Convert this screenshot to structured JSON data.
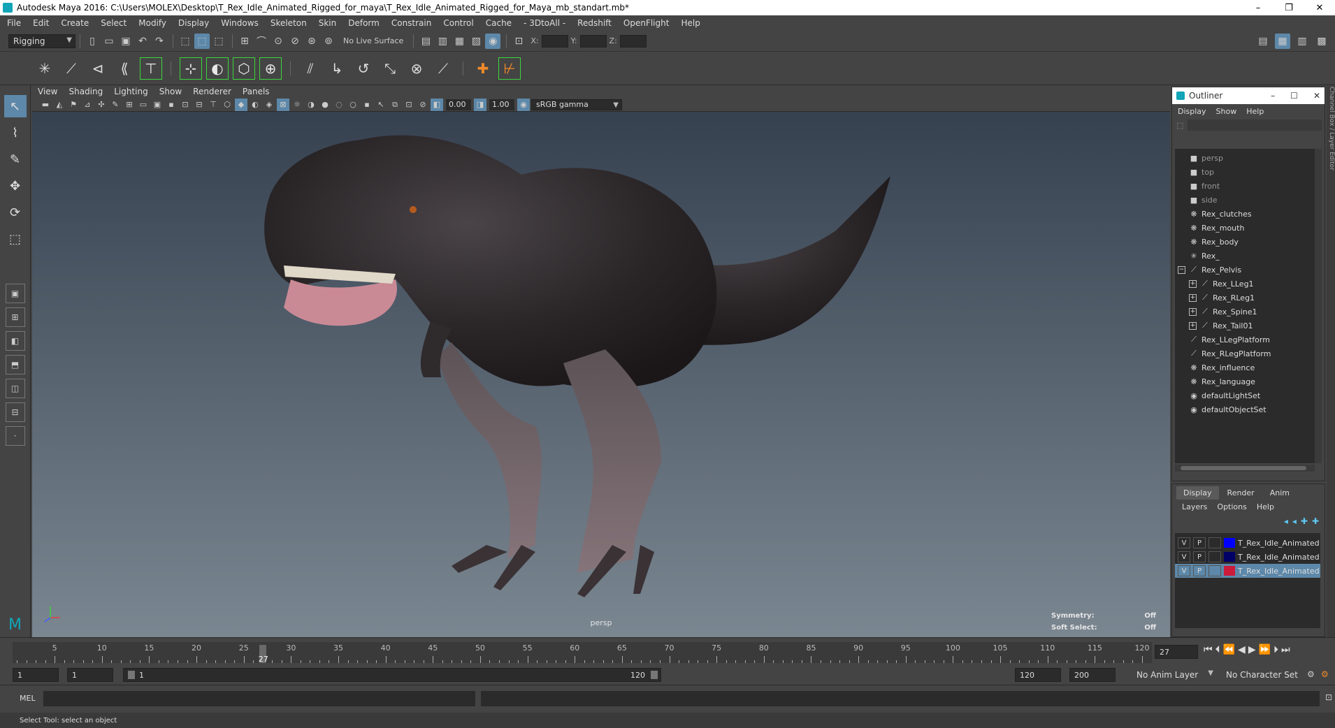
{
  "title": "Autodesk Maya 2016: C:\\Users\\MOLEX\\Desktop\\T_Rex_Idle_Animated_Rigged_for_maya\\T_Rex_Idle_Animated_Rigged_for_Maya_mb_standart.mb*",
  "window_buttons": [
    "–",
    "❐",
    "✕"
  ],
  "menu": [
    "File",
    "Edit",
    "Create",
    "Select",
    "Modify",
    "Display",
    "Windows",
    "Skeleton",
    "Skin",
    "Deform",
    "Constrain",
    "Control",
    "Cache",
    "- 3DtoAll -",
    "Redshift",
    "OpenFlight",
    "Help"
  ],
  "statusline": {
    "menuset": "Rigging",
    "live_surface": "No Live Surface",
    "x_label": "X:",
    "y_label": "Y:",
    "z_label": "Z:"
  },
  "panel_menu": [
    "View",
    "Shading",
    "Lighting",
    "Show",
    "Renderer",
    "Panels"
  ],
  "panel_toolbar": {
    "exposure": "0.00",
    "gamma": "1.00",
    "color_space": "sRGB gamma"
  },
  "viewport": {
    "camera": "persp",
    "symmetry_label": "Symmetry:",
    "symmetry_value": "Off",
    "soft_select_label": "Soft Select:",
    "soft_select_value": "Off"
  },
  "outliner": {
    "title": "Outliner",
    "menu": [
      "Display",
      "Show",
      "Help"
    ],
    "items": [
      {
        "label": "persp",
        "icon": "camera-icon",
        "dim": true
      },
      {
        "label": "top",
        "icon": "camera-icon",
        "dim": true
      },
      {
        "label": "front",
        "icon": "camera-icon",
        "dim": true
      },
      {
        "label": "side",
        "icon": "camera-icon",
        "dim": true
      },
      {
        "label": "Rex_clutches",
        "icon": "mesh-icon"
      },
      {
        "label": "Rex_mouth",
        "icon": "mesh-icon"
      },
      {
        "label": "Rex_body",
        "icon": "mesh-icon"
      },
      {
        "label": "Rex_",
        "icon": "locator-icon"
      },
      {
        "label": "Rex_Pelvis",
        "icon": "joint-icon",
        "expander": "−"
      },
      {
        "label": "Rex_LLeg1",
        "icon": "joint-icon",
        "expander": "+",
        "child": true
      },
      {
        "label": "Rex_RLeg1",
        "icon": "joint-icon",
        "expander": "+",
        "child": true
      },
      {
        "label": "Rex_Spine1",
        "icon": "joint-icon",
        "expander": "+",
        "child": true
      },
      {
        "label": "Rex_Tail01",
        "icon": "joint-icon",
        "expander": "+",
        "child": true
      },
      {
        "label": "Rex_LLegPlatform",
        "icon": "joint-icon"
      },
      {
        "label": "Rex_RLegPlatform",
        "icon": "joint-icon"
      },
      {
        "label": "Rex_influence",
        "icon": "mesh-icon"
      },
      {
        "label": "Rex_language",
        "icon": "mesh-icon"
      },
      {
        "label": "defaultLightSet",
        "icon": "set-icon"
      },
      {
        "label": "defaultObjectSet",
        "icon": "set-icon"
      }
    ]
  },
  "channel_strip": "Channel Box / Layer Editor",
  "layer_editor": {
    "tabs": [
      "Display",
      "Render",
      "Anim"
    ],
    "menu": [
      "Layers",
      "Options",
      "Help"
    ],
    "layers": [
      {
        "v": "V",
        "p": "P",
        "color": "#0000ff",
        "name": "T_Rex_Idle_Animated_R"
      },
      {
        "v": "V",
        "p": "P",
        "color": "#000066",
        "name": "T_Rex_Idle_Animated_R"
      },
      {
        "v": "V",
        "p": "P",
        "color": "#cc1a3a",
        "name": "T_Rex_Idle_Animated_R",
        "selected": true
      }
    ]
  },
  "timeline": {
    "labels": [
      "5",
      "10",
      "15",
      "20",
      "25",
      "30",
      "35",
      "40",
      "45",
      "50",
      "55",
      "60",
      "65",
      "70",
      "75",
      "80",
      "85",
      "90",
      "95",
      "100",
      "105",
      "110",
      "115",
      "120"
    ],
    "current": "27",
    "current_field": "27"
  },
  "range": {
    "start": "1",
    "playback_start": "1",
    "slider_start": "1",
    "slider_end": "120",
    "playback_end": "120",
    "end": "200",
    "anim_layer": "No Anim Layer",
    "character_set": "No Character Set"
  },
  "command": {
    "label": "MEL",
    "help": "Select Tool: select an object"
  }
}
